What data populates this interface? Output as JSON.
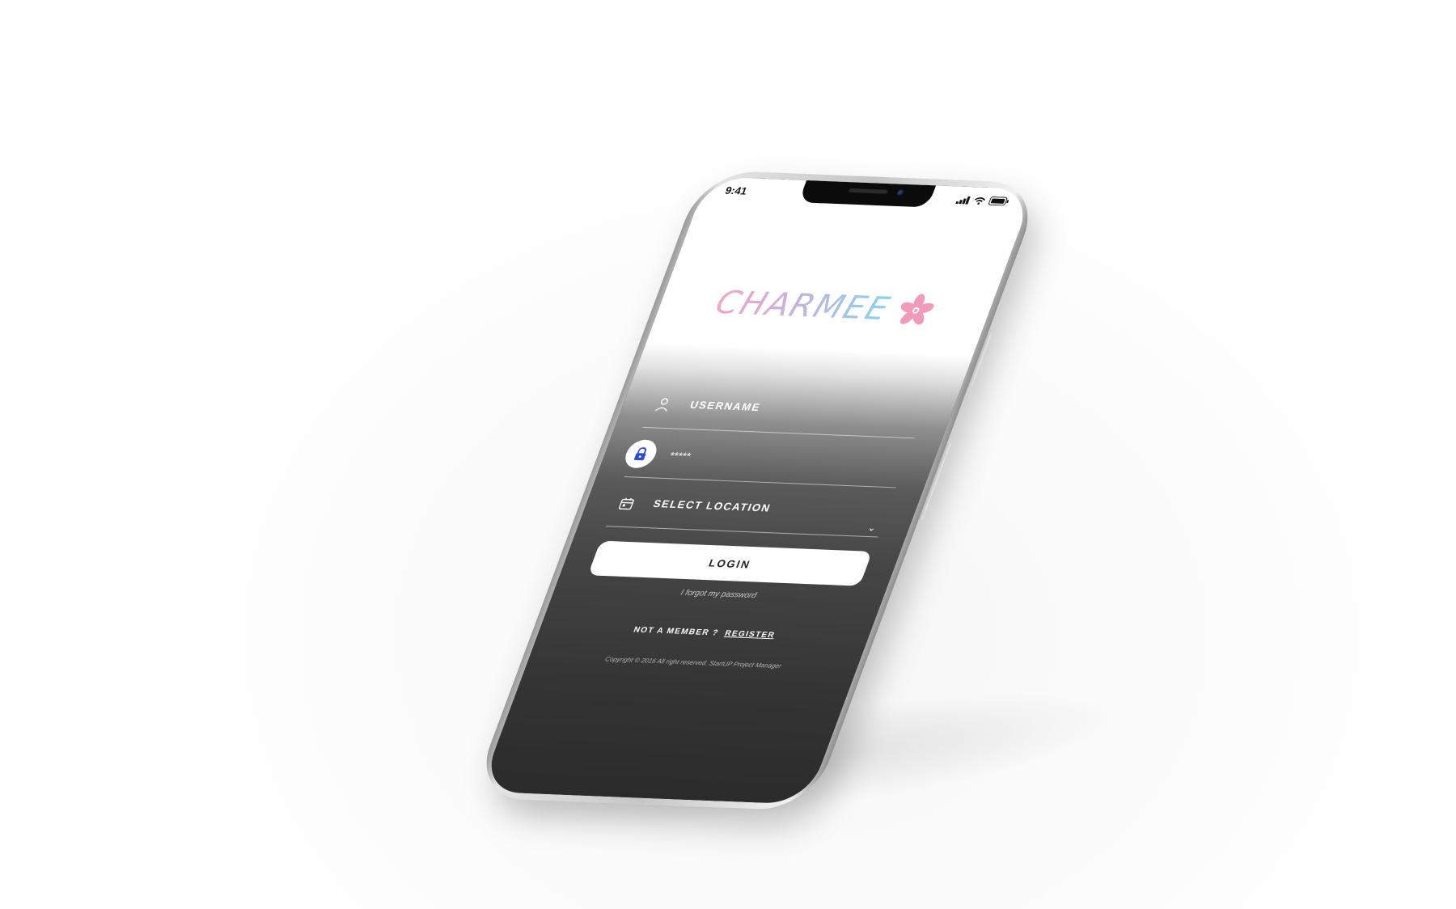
{
  "status_bar": {
    "time": "9:41"
  },
  "app": {
    "logo_text": "CHARMEE",
    "logo_icon": "cherry-blossom-icon",
    "brand_colors": {
      "pink": "#f2a7c4",
      "blue": "#88d3ee"
    }
  },
  "form": {
    "username_label": "USERNAME",
    "password_value": "*****",
    "location_label": "SELECT LOCATION",
    "login_button": "LOGIN",
    "forgot_password": "I forgot my password",
    "not_member": "NOT A MEMBER ?",
    "register": "REGISTER",
    "copyright": "Copyright © 2016 All right reserved. StartUP Project Manager"
  },
  "icons": {
    "username": "user-icon",
    "password": "lock-icon",
    "location": "calendar-icon",
    "dropdown": "chevron-down-icon",
    "signal": "signal-icon",
    "wifi": "wifi-icon",
    "battery": "battery-icon"
  },
  "colors": {
    "lock_icon": "#2f4bd6",
    "screen_dark": "#2b2b2b"
  }
}
